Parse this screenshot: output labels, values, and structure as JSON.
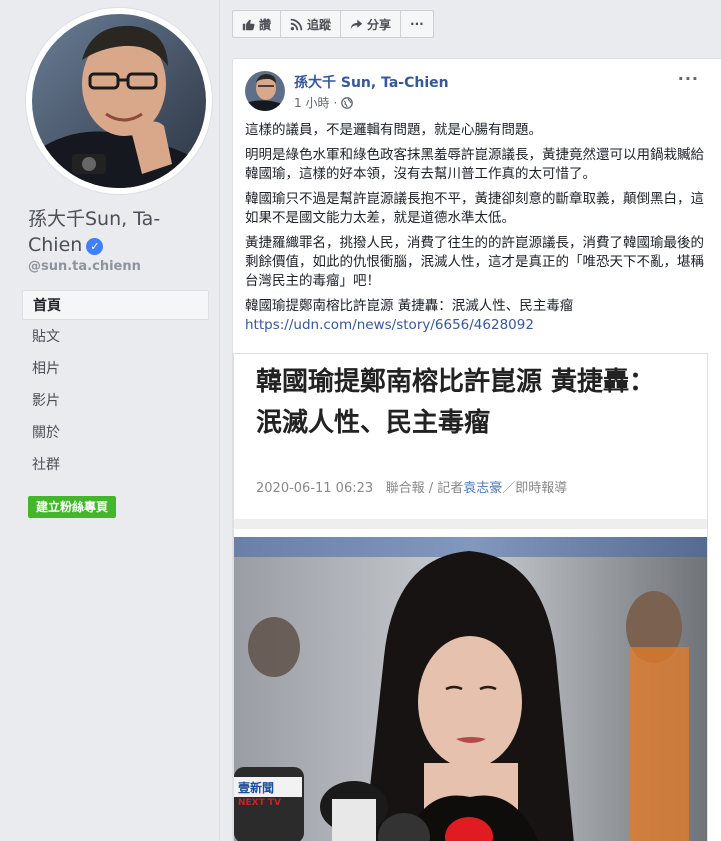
{
  "profile": {
    "name": "孫大千Sun, Ta-Chien",
    "handle": "@sun.ta.chienn"
  },
  "nav": {
    "items": [
      {
        "label": "首頁",
        "active": true
      },
      {
        "label": "貼文"
      },
      {
        "label": "相片"
      },
      {
        "label": "影片"
      },
      {
        "label": "關於"
      },
      {
        "label": "社群"
      }
    ],
    "create_button": "建立粉絲專頁"
  },
  "actions": {
    "like": "讚",
    "follow": "追蹤",
    "share": "分享",
    "more": "···"
  },
  "post": {
    "author": "孫大千 Sun, Ta-Chien",
    "time": "1 小時",
    "more": "···",
    "paragraphs": [
      "這樣的議員，不是邏輯有問題，就是心腸有問題。",
      "明明是綠色水軍和綠色政客抹黑羞辱許崑源議長，黃捷竟然還可以用鍋栽贓給韓國瑜，這樣的好本領，沒有去幫川普工作真的太可惜了。",
      "韓國瑜只不過是幫許崑源議長抱不平，黃捷卻刻意的斷章取義，顛倒黑白，這如果不是國文能力太差，就是道德水準太低。",
      "黃捷羅織罪名，挑撥人民，消費了往生的的許崑源議長，消費了韓國瑜最後的剩餘價值，如此的仇恨衝腦，泯滅人性，這才是真正的「唯恐天下不亂，堪稱台灣民主的毒瘤」吧！"
    ],
    "link_title": "韓國瑜提鄭南榕比許崑源 黃捷轟：泯滅人性、民主毒瘤",
    "link_url": "https://udn.com/news/story/6656/4628092"
  },
  "article": {
    "headline": "韓國瑜提鄭南榕比許崑源 黃捷轟：泯滅人性、民主毒瘤",
    "date": "2020-06-11 06:23",
    "source": "聯合報 / 記者",
    "reporter": "袁志豪",
    "section": "／即時報導",
    "mic_label_1": "壹新聞",
    "mic_label_2": "NEXT TV"
  }
}
